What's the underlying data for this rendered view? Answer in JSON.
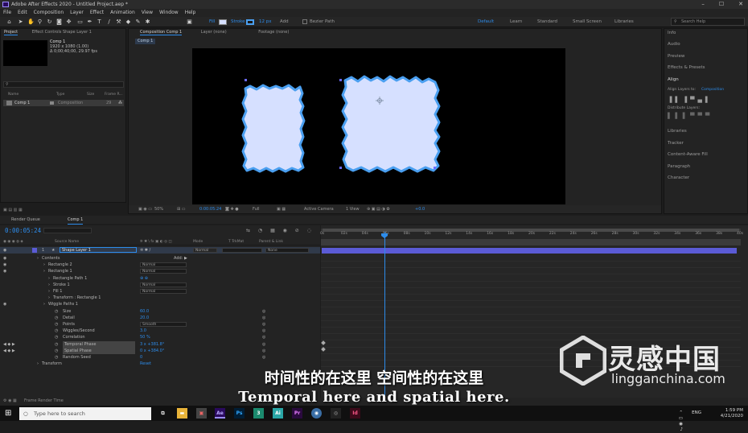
{
  "window": {
    "title": "Adobe After Effects 2020 - Untitled Project.aep *"
  },
  "menu": [
    "File",
    "Edit",
    "Composition",
    "Layer",
    "Effect",
    "Animation",
    "View",
    "Window",
    "Help"
  ],
  "toolbar": {
    "fill_label": "Fill",
    "stroke_label": "Stroke",
    "stroke_px": "12 px",
    "add_label": "Add",
    "bezier_label": "Bezier Path",
    "workspaces": [
      "Default",
      "Learn",
      "Standard",
      "Small Screen",
      "Libraries"
    ],
    "search_placeholder": "Search Help"
  },
  "project_panel": {
    "tab": "Project",
    "effect_controls_tab": "Effect Controls  Shape Layer 1",
    "comp_name": "Comp 1",
    "comp_info": [
      "1920 x 1080 (1.00)",
      "Δ 0;00;40;00, 29.97 fps"
    ],
    "columns": [
      "Name",
      "Type",
      "Size",
      "Frame R..."
    ],
    "item": {
      "name": "Comp 1",
      "type": "Composition",
      "frame_rate": "29"
    }
  },
  "composition_panel": {
    "tab": "Composition  Comp 1",
    "layer_tab": "Layer  (none)",
    "footage_tab": "Footage  (none)",
    "comp_chip": "Comp 1",
    "zoom": "50%",
    "time": "0:00:05:24",
    "resolution": "Full",
    "camera": "Active Camera",
    "views": "1 View",
    "exposure": "+0.0"
  },
  "right_panel": {
    "items": [
      "Info",
      "Audio",
      "Preview",
      "Effects & Presets",
      "Align",
      "Align Layers to:",
      "Composition",
      "Distribute Layers:",
      "Libraries",
      "Tracker",
      "Content-Aware Fill",
      "Paragraph",
      "Character"
    ]
  },
  "timeline": {
    "render_queue_tab": "Render Queue",
    "comp_tab": "Comp 1",
    "timecode": "0:00:05:24",
    "columns": {
      "source_name": "Source Name",
      "mode": "Mode",
      "trkmat": "T  TrkMat",
      "parent": "Parent & Link"
    },
    "ruler_ticks": [
      "0s",
      "02s",
      "04s",
      "06s",
      "08s",
      "10s",
      "12s",
      "14s",
      "16s",
      "18s",
      "20s",
      "22s",
      "24s",
      "26s",
      "28s",
      "30s",
      "32s",
      "34s",
      "36s",
      "38s",
      "40s"
    ],
    "layer": {
      "num": "1",
      "name": "Shape Layer 1",
      "mode": "Normal",
      "parent": "None"
    },
    "rows": [
      {
        "label": "Contents",
        "indent": 1,
        "extra": "Add: ▶"
      },
      {
        "label": "Rectangle 2",
        "indent": 2,
        "mode": "Normal"
      },
      {
        "label": "Rectangle 1",
        "indent": 2,
        "mode": "Normal"
      },
      {
        "label": "Rectangle Path 1",
        "indent": 3,
        "value": "⊕ ⊕"
      },
      {
        "label": "Stroke 1",
        "indent": 3,
        "mode": "Normal"
      },
      {
        "label": "Fill 1",
        "indent": 3,
        "mode": "Normal"
      },
      {
        "label": "Transform : Rectangle 1",
        "indent": 3
      },
      {
        "label": "Wiggle Paths 1",
        "indent": 2
      },
      {
        "label": "Size",
        "indent": 4,
        "value": "60.0"
      },
      {
        "label": "Detail",
        "indent": 4,
        "value": "20.0"
      },
      {
        "label": "Points",
        "indent": 4,
        "mode": "Smooth"
      },
      {
        "label": "Wiggles/Second",
        "indent": 4,
        "value": "3.0"
      },
      {
        "label": "Correlation",
        "indent": 4,
        "value": "50 %"
      },
      {
        "label": "Temporal Phase",
        "indent": 4,
        "value": "3 x +381.8°"
      },
      {
        "label": "Spatial Phase",
        "indent": 4,
        "value": "0 x +384.0°"
      },
      {
        "label": "Random Seed",
        "indent": 4,
        "value": "0"
      },
      {
        "label": "Transform",
        "indent": 1,
        "value": "Reset"
      }
    ],
    "frame_render": "Frame Render Time"
  },
  "subtitles": {
    "cn": "时间性的在这里 空间性的在这里",
    "en": "Temporal here and spatial here."
  },
  "watermark": {
    "text": "灵感中国",
    "url": "lingganchina.com"
  },
  "taskbar": {
    "search_placeholder": "Type here to search",
    "apps": [
      "Ae",
      "Ps",
      "3",
      "Ai",
      "Pr",
      "Id"
    ],
    "lang": "ENG",
    "time": "1:59 PM",
    "date": "4/21/2020"
  },
  "colors": {
    "accent": "#2d8ceb",
    "shape_fill": "#d6e0ff",
    "shape_stroke": "#4a9ff0"
  }
}
